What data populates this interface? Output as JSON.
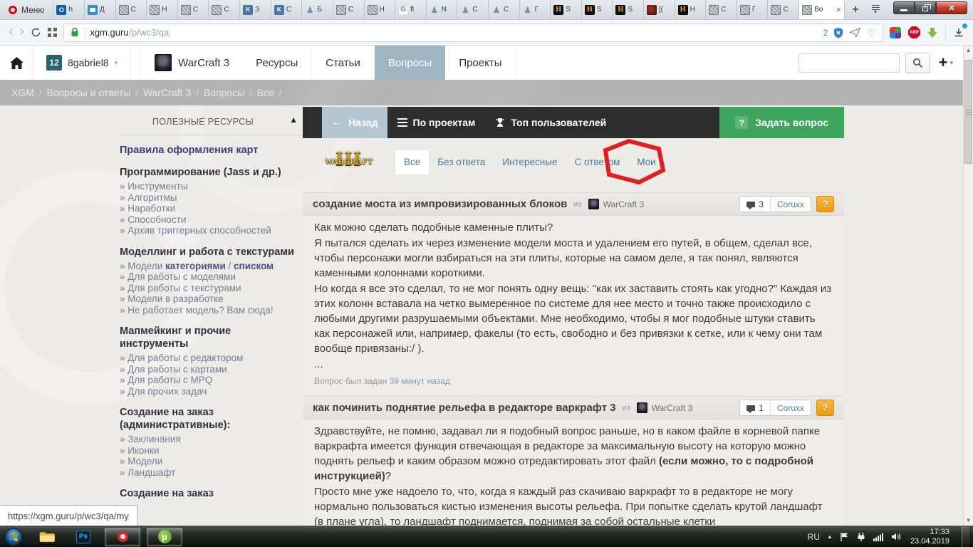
{
  "browser": {
    "menu_label": "Меню",
    "tabs": [
      {
        "icon": "outlook-icon",
        "label": "h"
      },
      {
        "icon": "chat-icon",
        "label": "Д"
      },
      {
        "icon": "page-icon",
        "label": "С"
      },
      {
        "icon": "page-icon",
        "label": "Н"
      },
      {
        "icon": "page-icon",
        "label": "С"
      },
      {
        "icon": "page-icon",
        "label": "С"
      },
      {
        "icon": "vk-icon",
        "label": "З"
      },
      {
        "icon": "vk-icon",
        "label": "С"
      },
      {
        "icon": "statue-icon",
        "label": "Б"
      },
      {
        "icon": "page-icon",
        "label": "С"
      },
      {
        "icon": "page-icon",
        "label": "Н"
      },
      {
        "icon": "google-icon",
        "label": "fl"
      },
      {
        "icon": "statue-icon",
        "label": "N"
      },
      {
        "icon": "statue-icon",
        "label": "С"
      },
      {
        "icon": "statue-icon",
        "label": "С"
      },
      {
        "icon": "statue-icon",
        "label": "Г"
      },
      {
        "icon": "hearthstone-icon",
        "label": "S"
      },
      {
        "icon": "hearthstone-icon",
        "label": "S"
      },
      {
        "icon": "hearthstone-icon",
        "label": "S"
      },
      {
        "icon": "demon-icon",
        "label": "[("
      },
      {
        "icon": "hearthstone-icon",
        "label": "Н"
      },
      {
        "icon": "page-icon",
        "label": "С"
      },
      {
        "icon": "page-icon",
        "label": "Г"
      },
      {
        "icon": "page-icon",
        "label": "С"
      },
      {
        "icon": "page-icon",
        "label": "Во",
        "active": true
      }
    ],
    "address": {
      "host": "xgm.guru",
      "path": "/p/wc3/qa",
      "blocked_count": "2"
    }
  },
  "site_header": {
    "avatar_text": "12",
    "username": "8gabriel8",
    "site_name": "WarCraft 3",
    "nav": [
      {
        "label": "Ресурсы"
      },
      {
        "label": "Статьи"
      },
      {
        "label": "Вопросы",
        "active": true
      },
      {
        "label": "Проекты"
      }
    ]
  },
  "breadcrumb": {
    "items": [
      "XGM",
      "Вопросы и ответы",
      "WarCraft 3",
      "Вопросы",
      "Все"
    ]
  },
  "toolbar": {
    "back": "Назад",
    "projects": "По проектам",
    "top_users": "Топ пользователей",
    "ask": "Задать вопрос",
    "ask_icon": "?"
  },
  "filters": {
    "logo_small": "WARCRAFT",
    "logo_big": "III",
    "tabs": [
      {
        "label": "Все",
        "active": true
      },
      {
        "label": "Без ответа"
      },
      {
        "label": "Интересные"
      },
      {
        "label": "С ответом"
      },
      {
        "label": "Мои"
      }
    ]
  },
  "questions": [
    {
      "title": "создание моста из импровизированных блоков",
      "from_label": "из",
      "project": "WarCraft 3",
      "comment_count": "3",
      "author": "Coruxx",
      "help_badge": "?",
      "paragraphs": [
        [
          {
            "t": "Как можно сделать подобные каменные плиты?"
          }
        ],
        [
          {
            "t": "Я пытался сделать их через изменение модели моста и удалением его путей, в общем, сделал все, чтобы персонажи могли взбираться на эти плиты, которые на самом деле, я так понял, являются каменными колоннами короткими."
          }
        ],
        [
          {
            "t": "Но когда я все это сделал, то не мог понять одну вещь: \"как их заставить стоять как угодно?\" Каждая из этих колонн вставала на четко вымеренное по системе для нее место и точно также происходило с любыми другими разрушаемыми объектами. Мне необходимо, чтобы я мог подобные штуки ставить как персонажей или, например, факелы (то есть, свободно и без привязки к сетке, или к чему они там вообще привязаны:/ )."
          }
        ],
        [
          {
            "t": "..."
          }
        ]
      ],
      "footer": {
        "prefix": "Вопрос был задан",
        "time": "39 минут назад"
      }
    },
    {
      "title": "как починить поднятие рельефа в редакторе варкрафт 3",
      "from_label": "из",
      "project": "WarCraft 3",
      "comment_count": "1",
      "author": "Coruxx",
      "help_badge": "?",
      "paragraphs": [
        [
          {
            "t": "Здравствуйте, не помню, задавал ли я подобный вопрос раньше, но в каком файле в корневой папке варкрафта имеется функция отвечающая в редакторе за максимальную высоту на которую можно поднять рельеф и каким образом можно отредактировать этот файл "
          },
          {
            "t": "(если можно, то с подробной инструкцией)",
            "b": true
          },
          {
            "t": "?"
          }
        ],
        [
          {
            "t": "Просто мне уже надоело то, что, когда я каждый раз скачиваю варкрафт то в редакторе не могу нормально пользоваться кистью изменения высоты рельефа. При попытке сделать крутой ландшафт (в плане угла), то ландшафт поднимается, поднимая за собой остальные клетки"
          }
        ]
      ],
      "footer": null
    }
  ],
  "sidebar": {
    "header": "ПОЛЕЗНЫЕ РЕСУРСЫ",
    "bullet": "»",
    "sections": [
      {
        "title": "Правила оформления карт",
        "link": true,
        "items": []
      },
      {
        "title": "Программирование (Jass и др.)",
        "items": [
          [
            {
              "t": "Инструменты"
            }
          ],
          [
            {
              "t": "Алгоритмы"
            }
          ],
          [
            {
              "t": "Наработки"
            }
          ],
          [
            {
              "t": "Способности"
            }
          ],
          [
            {
              "t": "Архив триггерных способностей"
            }
          ]
        ]
      },
      {
        "title": "Моделлинг и работа с текстурами",
        "items": [
          [
            {
              "t": "Модели "
            },
            {
              "t": "категориями",
              "b": true
            },
            {
              "t": " / "
            },
            {
              "t": "списком",
              "b": true
            }
          ],
          [
            {
              "t": "Для работы с моделями"
            }
          ],
          [
            {
              "t": "Для работы с текстурами"
            }
          ],
          [
            {
              "t": "Модели в разработке"
            }
          ],
          [
            {
              "t": "Не работает модель? Вам сюда!"
            }
          ]
        ]
      },
      {
        "title": "Мапмейкинг и прочие инструменты",
        "items": [
          [
            {
              "t": "Для работы с редактором"
            }
          ],
          [
            {
              "t": "Для работы с картами"
            }
          ],
          [
            {
              "t": "Для работы с MPQ"
            }
          ],
          [
            {
              "t": "Для прочих задач"
            }
          ]
        ]
      },
      {
        "title": "Создание на заказ (административные):",
        "items": [
          [
            {
              "t": "Заклинания"
            }
          ],
          [
            {
              "t": "Иконки"
            }
          ],
          [
            {
              "t": "Модели"
            }
          ],
          [
            {
              "t": "Ландшафт"
            }
          ]
        ]
      },
      {
        "title": "Создание на заказ",
        "items": []
      }
    ]
  },
  "status_url": "https://xgm.guru/p/wc3/qa/my",
  "taskbar": {
    "photoshop_label": "Ps",
    "utorrent_label": "µ",
    "tray": {
      "lang": "RU",
      "time": "17:33",
      "date": "23.04.2019"
    }
  }
}
